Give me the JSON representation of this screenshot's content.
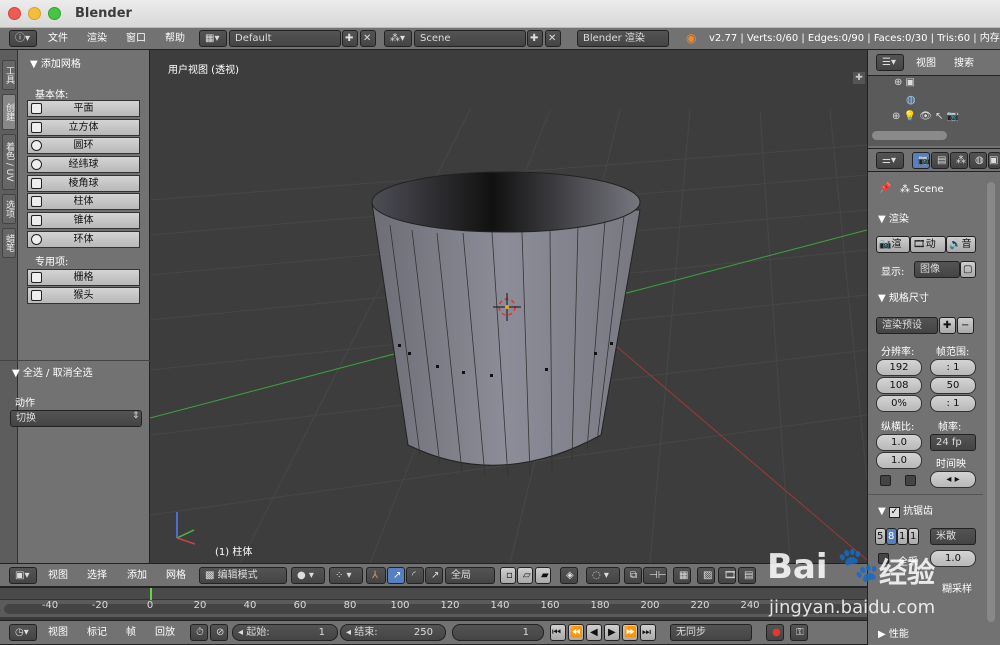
{
  "app": {
    "title": "Blender"
  },
  "info_header": {
    "menus": [
      "文件",
      "渲染",
      "窗口",
      "帮助"
    ],
    "layout": "Default",
    "scene": "Scene",
    "engine": "Blender 渲染",
    "stats": "v2.77 | Verts:0/60 | Edges:0/90 | Faces:0/30 | Tris:60 | 内存:3"
  },
  "toolshelf": {
    "tabs": [
      "工具",
      "创建",
      "着色 / UV",
      "选项",
      "蜡笔"
    ],
    "panel_title": "▼ 添加网格",
    "basic_label": "基本体:",
    "basic_items": [
      "平面",
      "立方体",
      "圆环",
      "经纬球",
      "棱角球",
      "柱体",
      "锥体",
      "环体"
    ],
    "special_label": "专用项:",
    "special_items": [
      "栅格",
      "猴头"
    ],
    "operator_title": "▼ 全选 / 取消全选",
    "action_label": "动作",
    "action_value": "切换"
  },
  "viewport": {
    "view_label": "用户视图 (透视)",
    "object_label": "(1) 柱体"
  },
  "view3d_header": {
    "menus": [
      "视图",
      "选择",
      "添加",
      "网格"
    ],
    "mode": "编辑模式",
    "orientation": "全局"
  },
  "timeline": {
    "ticks": [
      "-40",
      "-20",
      "0",
      "20",
      "40",
      "60",
      "80",
      "100",
      "120",
      "140",
      "160",
      "180",
      "200",
      "220",
      "240"
    ],
    "current_frame_marker": 0
  },
  "timeline_header": {
    "menus": [
      "视图",
      "标记",
      "帧",
      "回放"
    ],
    "start_label": "起始:",
    "start_value": "1",
    "end_label": "结束:",
    "end_value": "250",
    "current_frame": "1",
    "sync": "无同步"
  },
  "outliner": {
    "tabs": [
      "视图",
      "搜索"
    ]
  },
  "properties": {
    "context": "Scene",
    "render_section": "▼ 渲染",
    "render_buttons": [
      "渲",
      "动",
      "音"
    ],
    "display_label": "显示:",
    "display_value": "图像",
    "dimensions_section": "▼ 规格尺寸",
    "preset": "渲染预设",
    "resolution_label": "分辨率:",
    "res_x": "192",
    "res_y": "108",
    "res_pct": "0%",
    "frame_range_label": "帧范围:",
    "frame_start": ": 1",
    "frame_end": "50",
    "frame_step": ": 1",
    "aspect_label": "纵横比:",
    "aspect_x": "1.0",
    "aspect_y": "1.0",
    "fps_label": "帧率:",
    "fps_value": "24 fp",
    "time_remap_label": "时间映",
    "aa_section": "抗锯齿",
    "aa_samples": [
      "5",
      "8",
      "1",
      "1"
    ],
    "aa_filter": "米散",
    "full_sample_label": "全采",
    "filter_size": "1.0",
    "motion_blur": "糊采样",
    "performance": "▶ 性能"
  },
  "watermark": {
    "brand": "Bai",
    "brand2": "经验",
    "url": "jingyan.baidu.com"
  },
  "colors": {
    "x_axis": "#b53b3b",
    "y_axis": "#3fa43f",
    "selected_blue": "#5680c2"
  }
}
